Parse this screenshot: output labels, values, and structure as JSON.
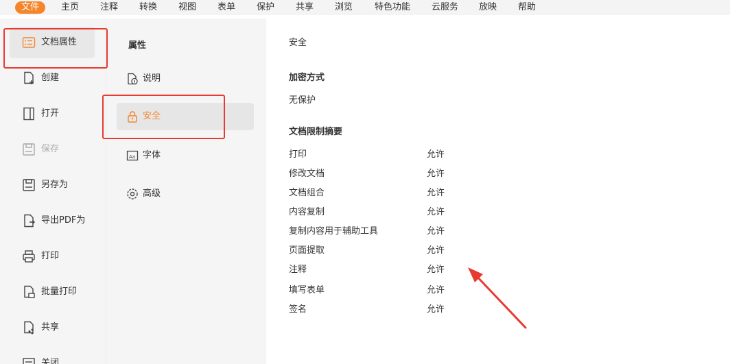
{
  "menu": {
    "items": [
      "文件",
      "主页",
      "注释",
      "转换",
      "视图",
      "表单",
      "保护",
      "共享",
      "浏览",
      "特色功能",
      "云服务",
      "放映",
      "帮助"
    ],
    "active_index": 0
  },
  "sidebar": {
    "items": [
      {
        "label": "文档属性",
        "icon": "document-properties-icon"
      },
      {
        "label": "创建",
        "icon": "new-document-icon"
      },
      {
        "label": "打开",
        "icon": "open-folder-icon"
      },
      {
        "label": "保存",
        "icon": "save-icon"
      },
      {
        "label": "另存为",
        "icon": "save-as-icon"
      },
      {
        "label": "导出PDF为",
        "icon": "export-icon"
      },
      {
        "label": "打印",
        "icon": "printer-icon"
      },
      {
        "label": "批量打印",
        "icon": "batch-print-icon"
      },
      {
        "label": "共享",
        "icon": "share-icon"
      },
      {
        "label": "关闭",
        "icon": "close-document-icon"
      }
    ],
    "selected_index": 0,
    "disabled_index": 3
  },
  "properties": {
    "title": "属性",
    "items": [
      {
        "label": "说明",
        "icon": "info-icon"
      },
      {
        "label": "安全",
        "icon": "lock-icon"
      },
      {
        "label": "字体",
        "icon": "font-icon"
      },
      {
        "label": "高级",
        "icon": "gear-icon"
      }
    ],
    "selected_index": 1
  },
  "security": {
    "title": "安全",
    "encryption_heading": "加密方式",
    "encryption_value": "无保护",
    "summary_heading": "文档限制摘要",
    "restrictions": [
      {
        "name": "打印",
        "value": "允许"
      },
      {
        "name": "修改文档",
        "value": "允许"
      },
      {
        "name": "文档组合",
        "value": "允许"
      },
      {
        "name": "内容复制",
        "value": "允许"
      },
      {
        "name": "复制内容用于辅助工具",
        "value": "允许"
      },
      {
        "name": "页面提取",
        "value": "允许"
      },
      {
        "name": "注释",
        "value": "允许"
      },
      {
        "name": "填写表单",
        "value": "允许"
      },
      {
        "name": "签名",
        "value": "允许"
      }
    ]
  },
  "colors": {
    "accent": "#f5852a",
    "annotation_red": "#e83a30",
    "sidebar_bg": "#f5f5f5"
  }
}
